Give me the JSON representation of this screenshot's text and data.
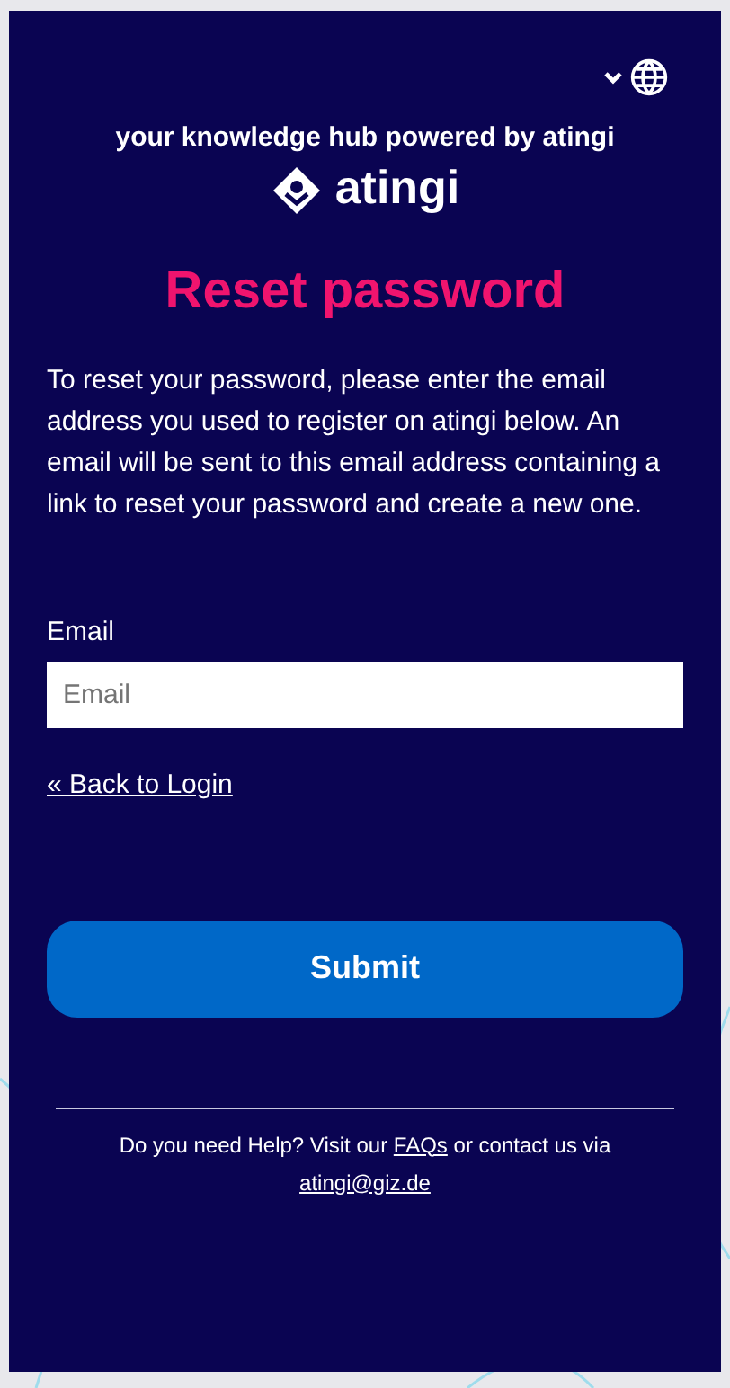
{
  "header": {
    "tagline": "your knowledge hub powered by atingi",
    "logo_text": "atingi"
  },
  "title": "Reset password",
  "instructions": "To reset your password, please enter the email address you used to register on atingi below. An email will be sent to this email address containing a link to reset your password and create a new one.",
  "email_field": {
    "label": "Email",
    "placeholder": "Email"
  },
  "back_link": "« Back to Login",
  "submit_button": "Submit",
  "footer": {
    "text_before": "Do you need Help? Visit our",
    "faq_link": "FAQs",
    "text_middle": "or contact us via",
    "email_link": "atingi@giz.de"
  }
}
